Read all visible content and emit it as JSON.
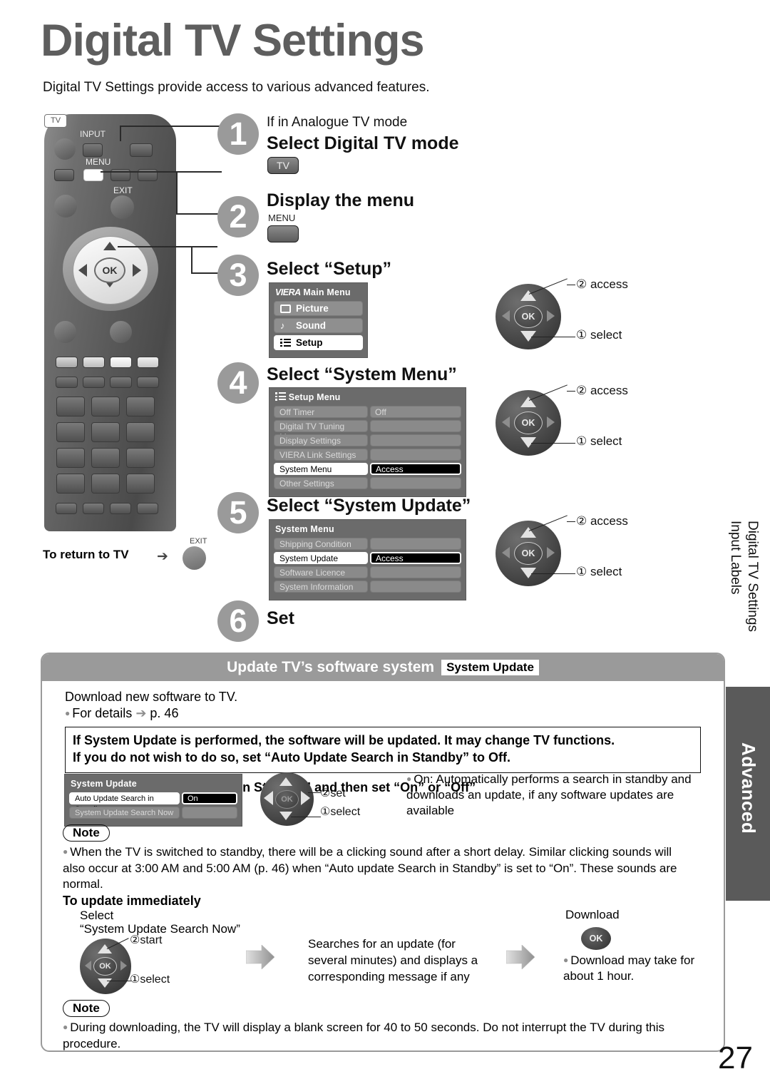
{
  "page": {
    "title": "Digital TV Settings",
    "subtitle": "Digital TV Settings provide access to various advanced features.",
    "number": "27"
  },
  "remote": {
    "input_label": "INPUT",
    "tv_button": "TV",
    "menu_label": "MENU",
    "exit_label": "EXIT",
    "ok_label": "OK",
    "return_label": "To return to TV",
    "return_arrow": "➔",
    "return_exit_label": "EXIT"
  },
  "steps": [
    {
      "num": "1",
      "pre": "If in Analogue TV mode",
      "heading": "Select Digital TV mode",
      "key": "TV"
    },
    {
      "num": "2",
      "heading": "Display the menu",
      "key_label": "MENU"
    },
    {
      "num": "3",
      "heading": "Select “Setup”"
    },
    {
      "num": "4",
      "heading": "Select “System Menu”"
    },
    {
      "num": "5",
      "heading": "Select “System Update”"
    },
    {
      "num": "6",
      "heading": "Set"
    }
  ],
  "main_menu": {
    "brand": "VIERA",
    "title": "Main Menu",
    "items": [
      {
        "label": "Picture",
        "icon": "picture-icon",
        "selected": false
      },
      {
        "label": "Sound",
        "icon": "music-note-icon",
        "selected": false
      },
      {
        "label": "Setup",
        "icon": "list-icon",
        "selected": true
      }
    ]
  },
  "setup_menu": {
    "title": "Setup Menu",
    "icon": "list-icon",
    "rows": [
      {
        "key": "Off Timer",
        "value": "Off",
        "state": "normal"
      },
      {
        "key": "Digital TV Tuning Menu",
        "value": "",
        "state": "normal"
      },
      {
        "key": "Display Settings",
        "value": "",
        "state": "normal"
      },
      {
        "key": "VIERA Link Settings",
        "value": "",
        "state": "normal"
      },
      {
        "key": "System Menu",
        "value": "Access",
        "state": "selected"
      },
      {
        "key": "Other Settings",
        "value": "",
        "state": "normal"
      }
    ]
  },
  "system_menu": {
    "title": "System Menu",
    "rows": [
      {
        "key": "Shipping Condition",
        "value": "",
        "state": "normal"
      },
      {
        "key": "System Update",
        "value": "Access",
        "state": "selected"
      },
      {
        "key": "Software Licence",
        "value": "",
        "state": "normal"
      },
      {
        "key": "System Information",
        "value": "",
        "state": "normal"
      }
    ]
  },
  "navpads": [
    {
      "access": "② access",
      "select": "① select"
    },
    {
      "access": "② access",
      "select": "① select"
    },
    {
      "access": "② access",
      "select": "① select"
    }
  ],
  "card": {
    "header_title": "Update TV’s software system",
    "header_badge": "System Update",
    "line1": "Download new software to TV.",
    "line2_text": "For details",
    "line2_arrow": "➔",
    "line2_page": "p. 46",
    "warning_line1": "If System Update is performed, the software will be updated. It may change TV functions.",
    "warning_line2": "If you do not wish to do so, set “Auto Update Search in Standby” to Off.",
    "select_line": "Select “Auto Update Search in Standby” and then set “On” or “Off”",
    "system_update_osd": {
      "title": "System Update",
      "rows": [
        {
          "key": "Auto Update Search in Standby",
          "value": "On",
          "state": "selected"
        },
        {
          "key": "System Update Search Now",
          "value": "",
          "state": "normal"
        }
      ]
    },
    "navpad_set": "②set",
    "navpad_select": "①select",
    "on_description": "On: Automatically performs a search in standby and downloads an update, if any software updates are available",
    "note1_tag": "Note",
    "note1_text": "When the TV is switched to standby, there will be a clicking sound after a short delay. Similar clicking sounds will also occur at 3:00 AM and 5:00 AM (p. 46) when “Auto update Search in Standby” is set to “On”. These sounds are normal.",
    "to_update_heading": "To update immediately",
    "flow": {
      "step1_line1": "Select",
      "step1_line2": "“System Update Search Now”",
      "step1_start": "②start",
      "step1_select": "①select",
      "step2_text": "Searches for an update (for several minutes) and displays a corresponding message if any",
      "step3_label": "Download",
      "step3_ok": "OK",
      "step3_note": "Download may take for about 1 hour."
    },
    "note2_tag": "Note",
    "note2_text": "During downloading, the TV will display a blank screen for 40 to 50 seconds. Do not interrupt the TV during this procedure."
  },
  "sidebar": {
    "tab_line1": "Input Labels",
    "tab_line2": "Digital TV Settings",
    "section": "Advanced"
  }
}
